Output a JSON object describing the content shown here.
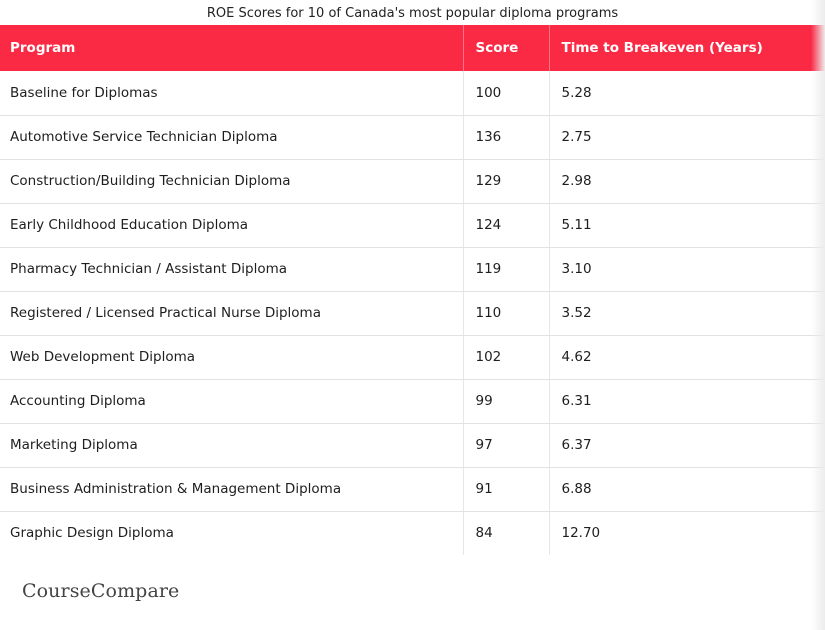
{
  "title": "ROE Scores for 10 of Canada's most popular diploma programs",
  "colors": {
    "header_bg": "#fb2a44",
    "header_text": "#ffffff"
  },
  "chart_data": {
    "type": "table",
    "title": "ROE Scores for 10 of Canada's most popular diploma programs",
    "columns": [
      "Program",
      "Score",
      "Time to Breakeven (Years)"
    ],
    "rows": [
      {
        "program": "Baseline for Diplomas",
        "score": "100",
        "time": "5.28"
      },
      {
        "program": "Automotive Service Technician Diploma",
        "score": "136",
        "time": "2.75"
      },
      {
        "program": "Construction/Building Technician Diploma",
        "score": "129",
        "time": "2.98"
      },
      {
        "program": "Early Childhood Education Diploma",
        "score": "124",
        "time": "5.11"
      },
      {
        "program": "Pharmacy Technician / Assistant Diploma",
        "score": "119",
        "time": "3.10"
      },
      {
        "program": "Registered / Licensed Practical Nurse Diploma",
        "score": "110",
        "time": "3.52"
      },
      {
        "program": "Web Development Diploma",
        "score": "102",
        "time": "4.62"
      },
      {
        "program": "Accounting Diploma",
        "score": "99",
        "time": "6.31"
      },
      {
        "program": "Marketing Diploma",
        "score": "97",
        "time": "6.37"
      },
      {
        "program": "Business Administration & Management Diploma",
        "score": "91",
        "time": "6.88"
      },
      {
        "program": "Graphic Design Diploma",
        "score": "84",
        "time": "12.70"
      }
    ]
  },
  "brand": {
    "logo_text": "CourseCompare"
  }
}
